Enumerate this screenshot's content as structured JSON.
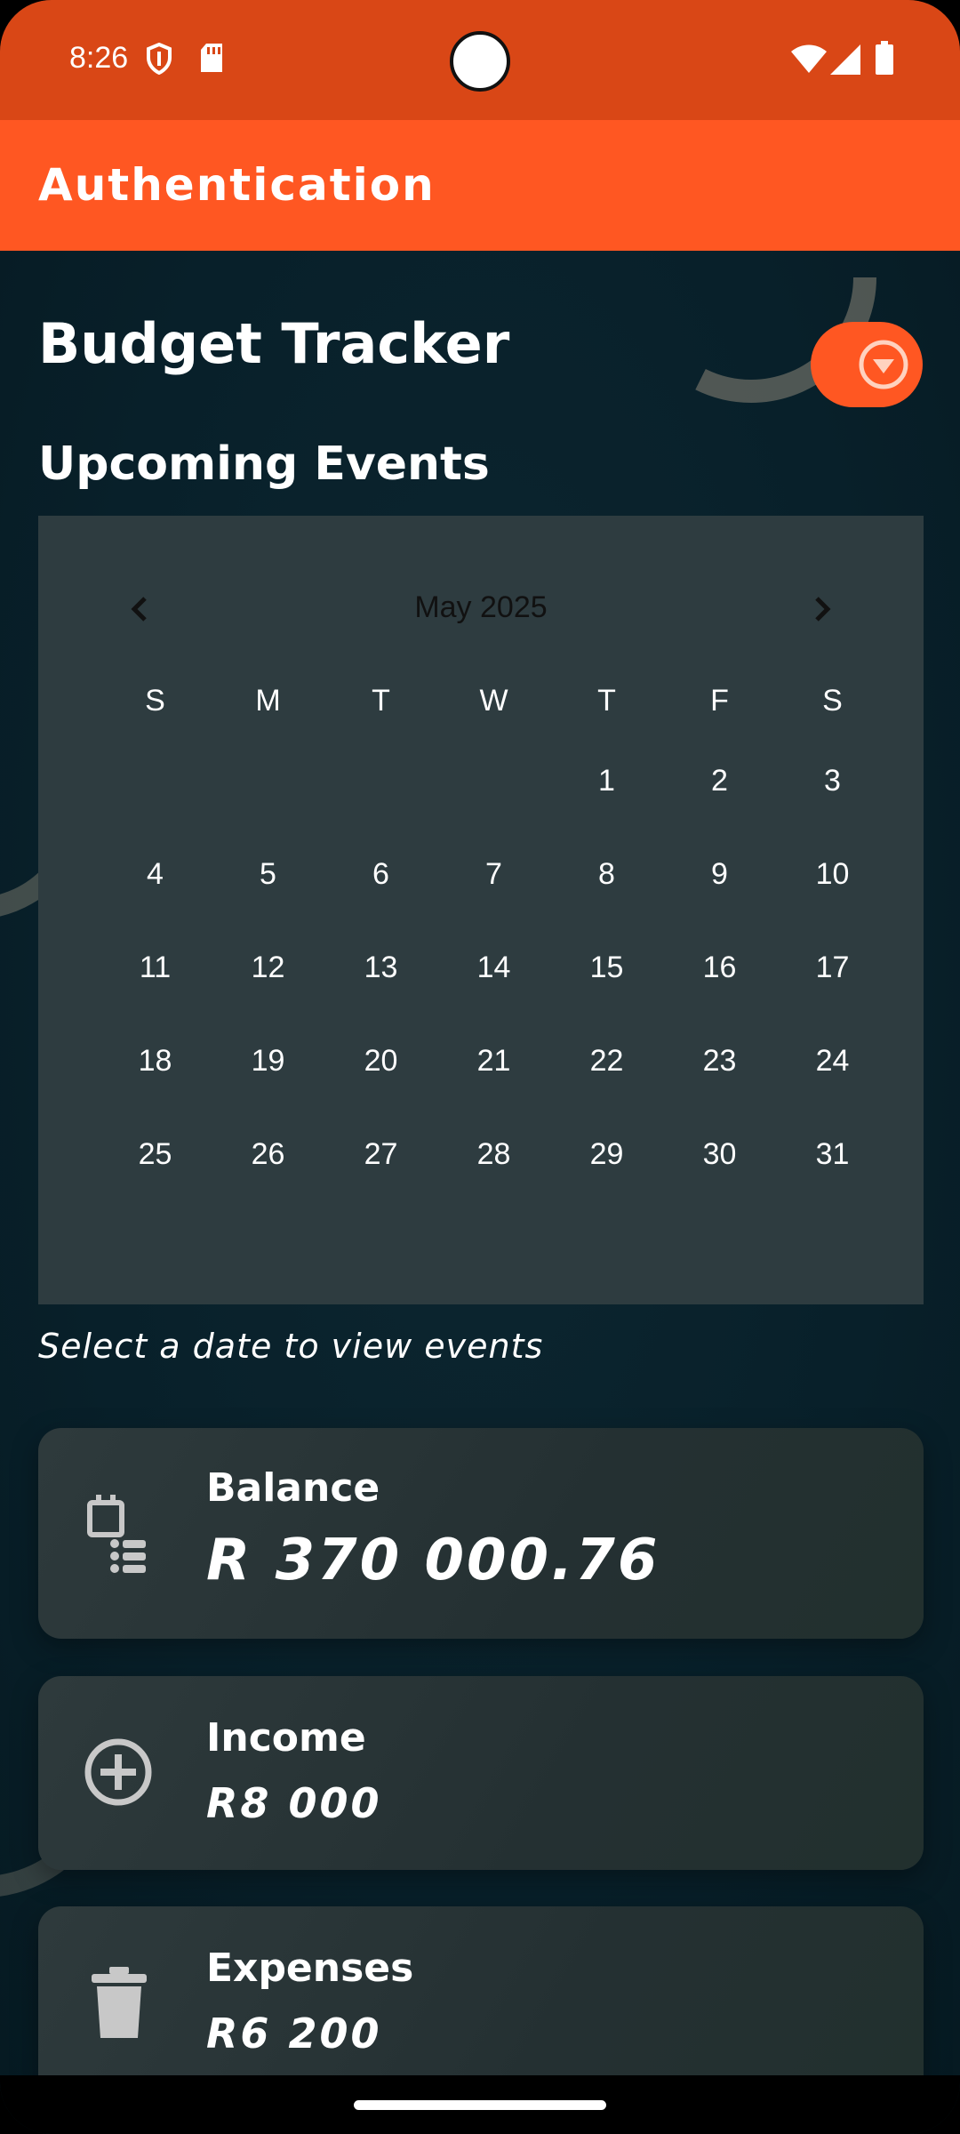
{
  "status_bar": {
    "time": "8:26",
    "icons": [
      "shield-icon",
      "sd-card-icon",
      "wifi-icon",
      "signal-icon",
      "battery-icon"
    ]
  },
  "app_bar": {
    "title": "Authentication"
  },
  "main": {
    "title": "Budget Tracker",
    "fab_icon": "chevron-down-circle-icon",
    "section_title": "Upcoming Events",
    "hint": "Select a date to view events"
  },
  "calendar": {
    "month_label": "May 2025",
    "prev_icon": "chevron-left-icon",
    "next_icon": "chevron-right-icon",
    "weekdays": [
      "S",
      "M",
      "T",
      "W",
      "T",
      "F",
      "S"
    ],
    "weeks": [
      [
        "",
        "",
        "",
        "",
        "1",
        "2",
        "3"
      ],
      [
        "4",
        "5",
        "6",
        "7",
        "8",
        "9",
        "10"
      ],
      [
        "11",
        "12",
        "13",
        "14",
        "15",
        "16",
        "17"
      ],
      [
        "18",
        "19",
        "20",
        "21",
        "22",
        "23",
        "24"
      ],
      [
        "25",
        "26",
        "27",
        "28",
        "29",
        "30",
        "31"
      ]
    ]
  },
  "cards": {
    "balance": {
      "label": "Balance",
      "value": "R 370 000.76",
      "icon": "calendar-list-icon"
    },
    "income": {
      "label": "Income",
      "value": "R8 000",
      "icon": "add-circle-icon"
    },
    "expenses": {
      "label": "Expenses",
      "value": "R6 200",
      "icon": "trash-icon"
    }
  },
  "colors": {
    "status_bar": "#d94716",
    "app_bar": "#ff5722",
    "background": "#0a1e26",
    "calendar": "#2e3c40",
    "card": "#2a3638"
  }
}
